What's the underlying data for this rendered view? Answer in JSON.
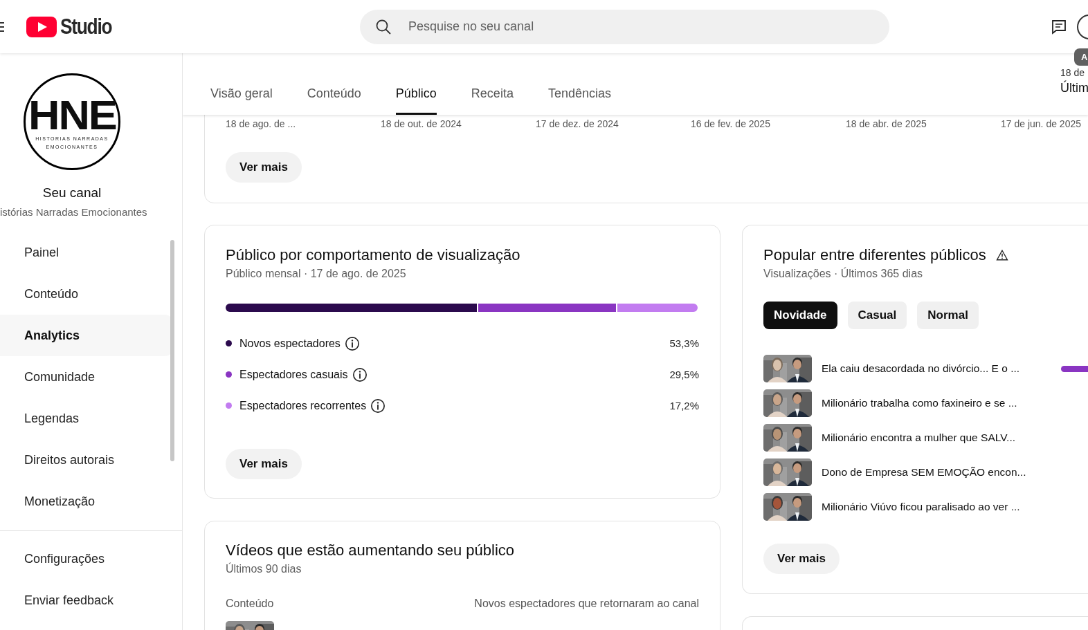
{
  "header": {
    "logo_text": "Studio",
    "search": {
      "placeholder": "Pesquise no seu canal"
    },
    "badge": "A"
  },
  "sidebar": {
    "channel_logo": {
      "initials": "HNE",
      "line_1": "HISTORIAS NARRADAS",
      "line_2": "EMOCIONANTES"
    },
    "channel_title": "Seu canal",
    "channel_name": "istórias Narradas Emocionantes",
    "items": [
      {
        "label": "Painel",
        "selected": false
      },
      {
        "label": "Conteúdo",
        "selected": false
      },
      {
        "label": "Analytics",
        "selected": true
      },
      {
        "label": "Comunidade",
        "selected": false
      },
      {
        "label": "Legendas",
        "selected": false
      },
      {
        "label": "Direitos autorais",
        "selected": false
      },
      {
        "label": "Monetização",
        "selected": false
      }
    ],
    "footer_items": [
      {
        "label": "Configurações"
      },
      {
        "label": "Enviar feedback"
      }
    ]
  },
  "tabs": [
    {
      "label": "Visão geral",
      "selected": false
    },
    {
      "label": "Conteúdo",
      "selected": false
    },
    {
      "label": "Público",
      "selected": true
    },
    {
      "label": "Receita",
      "selected": false
    },
    {
      "label": "Tendências",
      "selected": false
    }
  ],
  "date_range": {
    "date": "18 de",
    "period": "Últim"
  },
  "top_card": {
    "axis_labels": [
      "18 de ago. de ...",
      "18 de out. de 2024",
      "17 de dez. de 2024",
      "16 de fev. de 2025",
      "18 de abr. de 2025",
      "17 de jun. de 2025"
    ],
    "button": "Ver mais"
  },
  "behavior_card": {
    "title": "Público por comportamento de visualização",
    "subtitle": "Público mensal · 17 de ago. de 2025",
    "segments": [
      {
        "label": "Novos espectadores",
        "color": "#2b0a4d",
        "value": "53,3%"
      },
      {
        "label": "Espectadores casuais",
        "color": "#8a35c2",
        "value": "29,5%"
      },
      {
        "label": "Espectadores recorrentes",
        "color": "#c27cf0",
        "value": "17,2%"
      }
    ],
    "button": "Ver mais"
  },
  "growth_card": {
    "title": "Vídeos que estão aumentando seu público",
    "subtitle": "Últimos 90 dias",
    "columns": [
      "Conteúdo",
      "Novos espectadores que retornaram ao canal"
    ],
    "rows": [
      {
        "kind": "picture"
      }
    ]
  },
  "popular_card": {
    "title": "Popular entre diferentes públicos",
    "subtitle": "Visualizações · Últimos 365 dias",
    "chips": [
      {
        "label": "Novidade",
        "selected": true
      },
      {
        "label": "Casual",
        "selected": false
      },
      {
        "label": "Normal",
        "selected": false
      }
    ],
    "videos": [
      {
        "title": "Ela caiu desacordada no divórcio... E o ...",
        "bar_shown": true
      },
      {
        "title": "Milionário trabalha como faxineiro e se ...",
        "bar_shown": false
      },
      {
        "title": "Milionário encontra a mulher que SALV...",
        "bar_shown": false
      },
      {
        "title": "Dono de Empresa SEM EMOÇÃO encon...",
        "bar_shown": false
      },
      {
        "title": "Milionário Viúvo ficou paralisado ao ver ...",
        "bar_shown": false
      }
    ],
    "button": "Ver mais"
  }
}
